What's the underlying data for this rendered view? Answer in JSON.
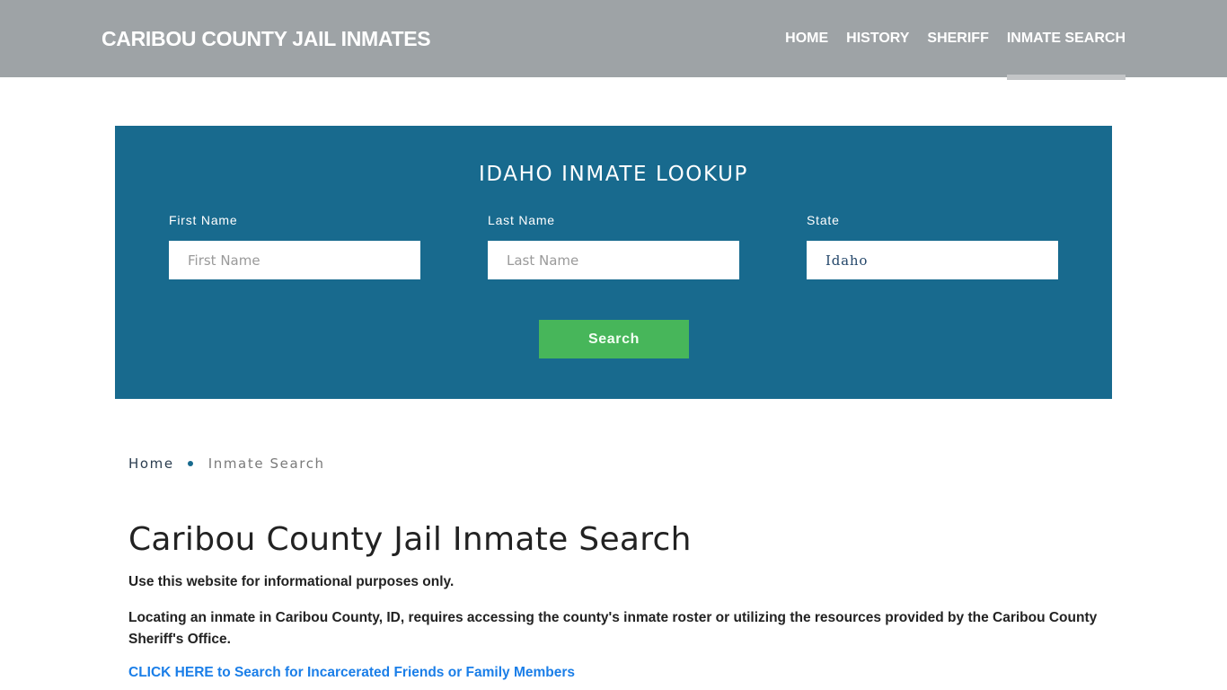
{
  "header": {
    "brand": "CARIBOU COUNTY JAIL INMATES",
    "nav": [
      {
        "label": "HOME",
        "active": false
      },
      {
        "label": "HISTORY",
        "active": false
      },
      {
        "label": "SHERIFF",
        "active": false
      },
      {
        "label": "INMATE SEARCH",
        "active": true
      }
    ]
  },
  "lookup": {
    "title": "IDAHO INMATE LOOKUP",
    "first_name": {
      "label": "First Name",
      "placeholder": "First Name",
      "value": ""
    },
    "last_name": {
      "label": "Last Name",
      "placeholder": "Last Name",
      "value": ""
    },
    "state": {
      "label": "State",
      "value": "Idaho"
    },
    "search_label": "Search",
    "colors": {
      "panel": "#186a8e",
      "button": "#47b65a"
    }
  },
  "breadcrumb": {
    "home": "Home",
    "current": "Inmate Search"
  },
  "main": {
    "title": "Caribou County Jail Inmate Search",
    "paragraphs": [
      "Use this website for informational purposes only.",
      "Locating an inmate in Caribou County, ID, requires accessing the county's inmate roster or utilizing the resources provided by the Caribou County Sheriff's Office."
    ],
    "cta_link": "CLICK HERE to Search for Incarcerated Friends or Family Members"
  }
}
